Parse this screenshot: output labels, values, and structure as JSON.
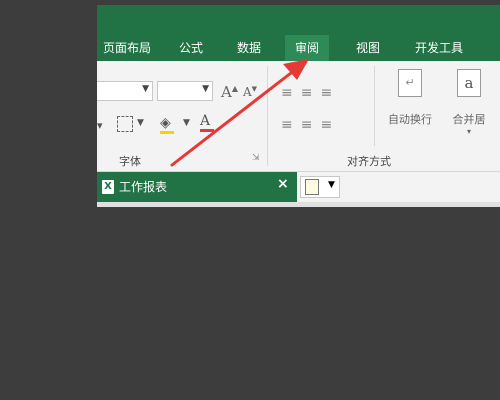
{
  "ribbon_tabs": [
    "页面布局",
    "公式",
    "数据",
    "审阅",
    "视图",
    "开发工具"
  ],
  "groups": {
    "font": "字体",
    "align": "对齐方式"
  },
  "buttons": {
    "wrap_text": "自动换行",
    "merge_center": "合并居"
  },
  "doc": {
    "name": "工作报表",
    "close": "×"
  },
  "colors": {
    "excel_green": "#217346",
    "active_tab": "#2e8b57",
    "arrow": "#e53935"
  },
  "icons": [
    "grow-font-icon",
    "shrink-font-icon",
    "borders-icon",
    "fill-color-icon",
    "font-color-icon",
    "align-icons",
    "excel-file-icon",
    "new-tab-icon"
  ]
}
